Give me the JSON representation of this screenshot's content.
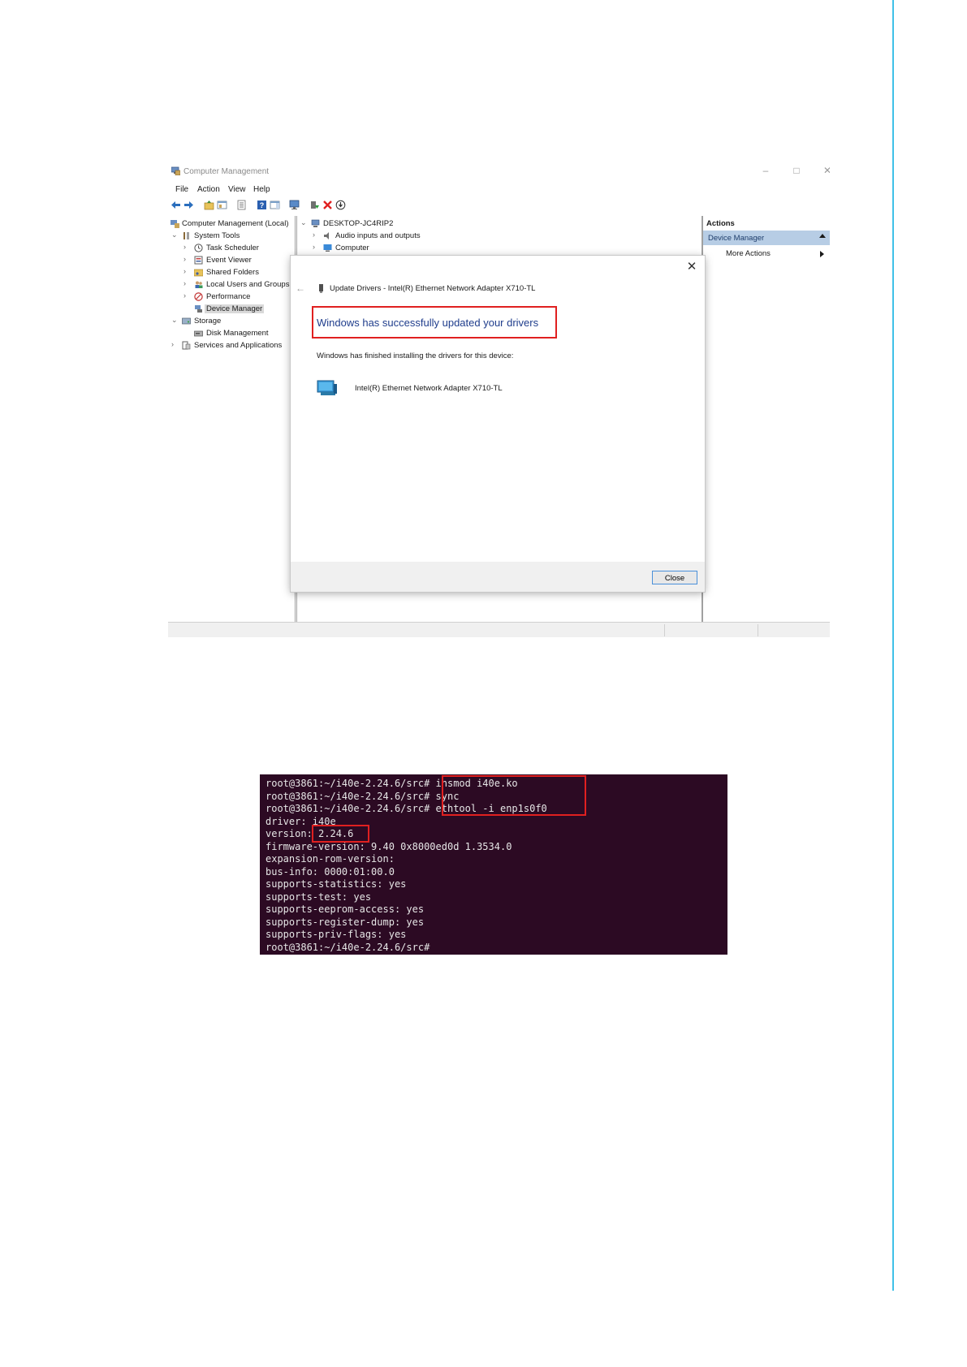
{
  "window": {
    "title": "Computer Management",
    "menu": [
      "File",
      "Action",
      "View",
      "Help"
    ],
    "tree": [
      {
        "label": "Computer Management (Local)",
        "icon": "computer-management-icon"
      },
      {
        "label": "System Tools",
        "icon": "system-tools-icon"
      },
      {
        "label": "Task Scheduler",
        "icon": "clock-icon"
      },
      {
        "label": "Event Viewer",
        "icon": "event-viewer-icon"
      },
      {
        "label": "Shared Folders",
        "icon": "shared-folder-icon"
      },
      {
        "label": "Local Users and Groups",
        "icon": "users-icon"
      },
      {
        "label": "Performance",
        "icon": "performance-icon"
      },
      {
        "label": "Device Manager",
        "icon": "device-manager-icon"
      },
      {
        "label": "Storage",
        "icon": "storage-icon"
      },
      {
        "label": "Disk Management",
        "icon": "disk-icon"
      },
      {
        "label": "Services and Applications",
        "icon": "services-icon"
      }
    ],
    "device_tree": [
      {
        "label": "DESKTOP-JC4RIP2",
        "icon": "computer-icon"
      },
      {
        "label": "Audio inputs and outputs",
        "icon": "speaker-icon"
      },
      {
        "label": "Computer",
        "icon": "monitor-icon"
      }
    ],
    "actions": {
      "header": "Actions",
      "section": "Device Manager",
      "more": "More Actions"
    }
  },
  "dialog": {
    "header": "Update Drivers - Intel(R) Ethernet Network Adapter X710-TL",
    "success": "Windows has successfully updated your drivers",
    "finished": "Windows has finished installing the drivers for this device:",
    "device": "Intel(R) Ethernet Network Adapter X710-TL",
    "close_label": "Close"
  },
  "terminal": {
    "lines": [
      "root@3861:~/i40e-2.24.6/src# insmod i40e.ko",
      "root@3861:~/i40e-2.24.6/src# sync",
      "root@3861:~/i40e-2.24.6/src# ethtool -i enp1s0f0",
      "driver: i40e",
      "version: 2.24.6",
      "firmware-version: 9.40 0x8000ed0d 1.3534.0",
      "expansion-rom-version:",
      "bus-info: 0000:01:00.0",
      "supports-statistics: yes",
      "supports-test: yes",
      "supports-eeprom-access: yes",
      "supports-register-dump: yes",
      "supports-priv-flags: yes",
      "root@3861:~/i40e-2.24.6/src#"
    ]
  },
  "colors": {
    "accent_line": "#3fc1e8",
    "highlight_red": "#e02020",
    "terminal_bg": "#2c0a23",
    "success_text": "#1f3d8c"
  }
}
